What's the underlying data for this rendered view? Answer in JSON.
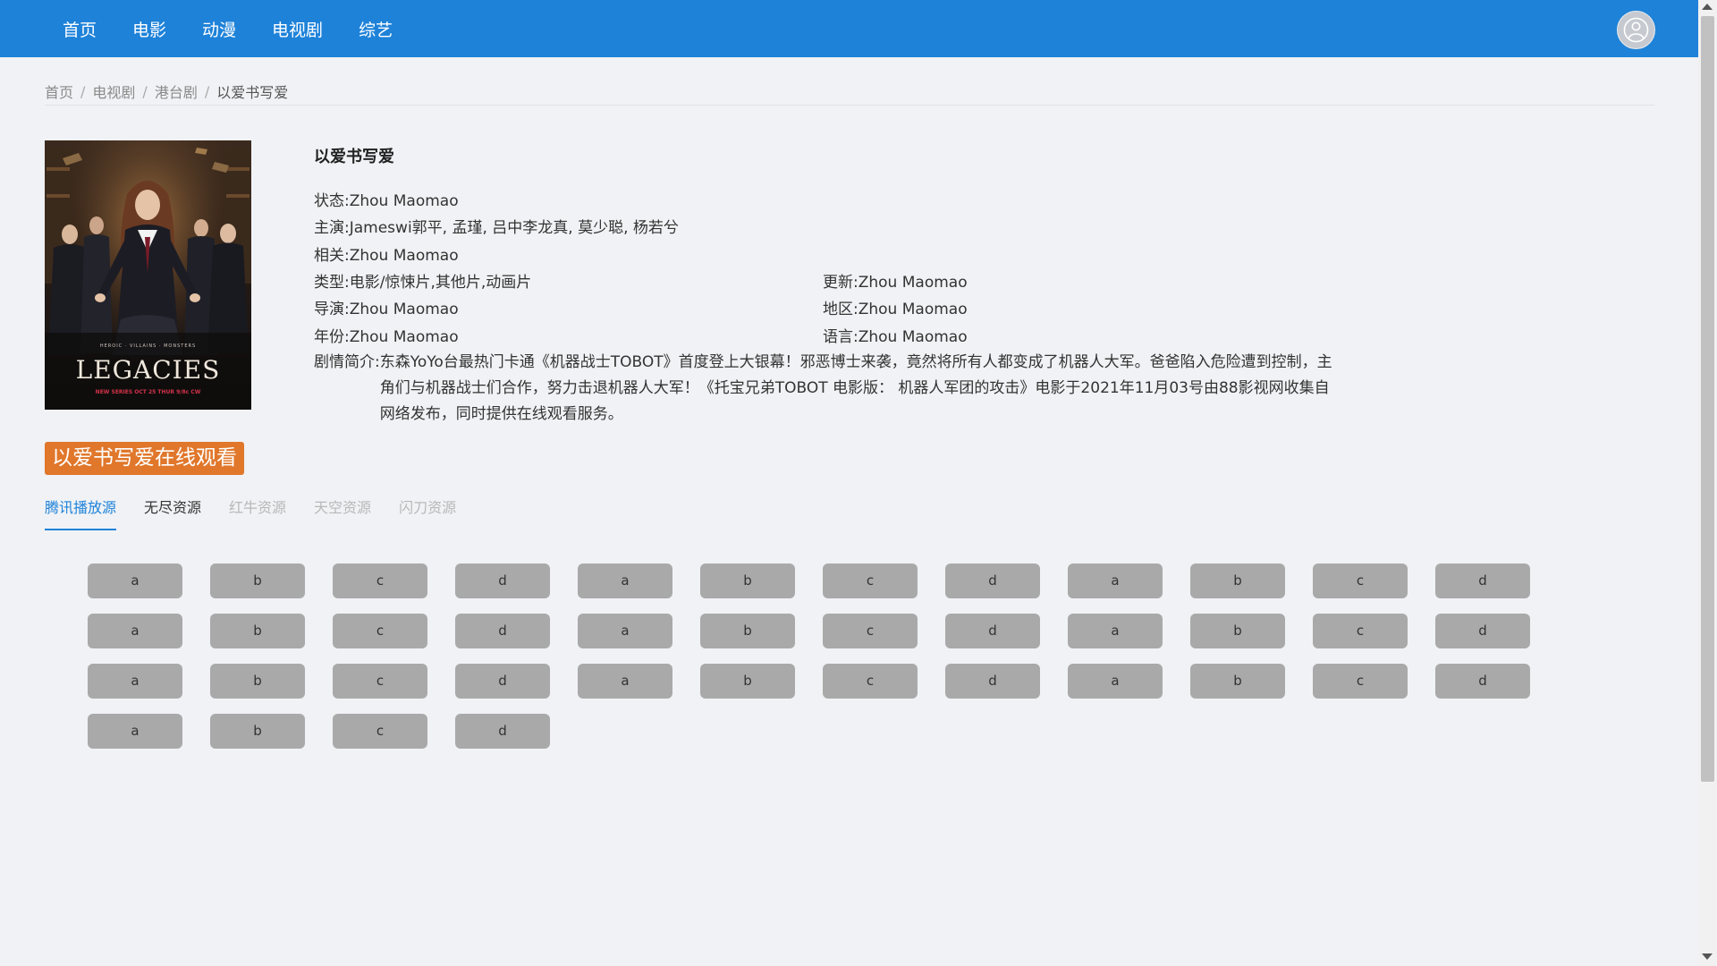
{
  "nav": {
    "items": [
      "首页",
      "电影",
      "动漫",
      "电视剧",
      "综艺"
    ],
    "avatar_icon": "user-avatar-icon"
  },
  "breadcrumb": {
    "items": [
      "首页",
      "电视剧",
      "港台剧"
    ],
    "current": "以爱书写爱",
    "separator": "/"
  },
  "poster": {
    "title_text": "LEGACIES",
    "tagline": "HEROIC · VILLAINS · MONSTERS",
    "date_text": "NEW SERIES OCT 25 THUR 9/8c",
    "network": "CW"
  },
  "info": {
    "title": "以爱书写爱",
    "status_label": "状态:",
    "status": "Zhou Maomao",
    "cast_label": "主演:",
    "cast": "Jameswi郭平, 孟瑾, 吕中李龙真, 莫少聪, 杨若兮",
    "related_label": "相关:",
    "related": "Zhou Maomao",
    "genre_label": "类型:",
    "genre": "电影/惊悚片,其他片,动画片",
    "update_label": "更新:",
    "update": "Zhou Maomao",
    "director_label": "导演:",
    "director": "Zhou Maomao",
    "region_label": "地区:",
    "region": "Zhou Maomao",
    "year_label": "年份:",
    "year": "Zhou Maomao",
    "language_label": "语言:",
    "language": "Zhou Maomao",
    "synopsis_label": "剧情简介:",
    "synopsis": "东森YoYo台最热门卡通《机器战士TOBOT》首度登上大银幕！邪恶博士来袭，竟然将所有人都变成了机器人大军。爸爸陷入危险遭到控制，主角们与机器战士们合作，努力击退机器人大军！《托宝兄弟TOBOT 电影版： 机器人军团的攻击》电影于2021年11月03号由88影视网收集自网络发布，同时提供在线观看服务。"
  },
  "watch_banner": "以爱书写爱在线观看",
  "source_tabs": [
    {
      "label": "腾讯播放源",
      "state": "active"
    },
    {
      "label": "无尽资源",
      "state": "normal"
    },
    {
      "label": "红牛资源",
      "state": "disabled"
    },
    {
      "label": "天空资源",
      "state": "disabled"
    },
    {
      "label": "闪刀资源",
      "state": "disabled"
    }
  ],
  "episodes": [
    "a",
    "b",
    "c",
    "d",
    "a",
    "b",
    "c",
    "d",
    "a",
    "b",
    "c",
    "d",
    "a",
    "b",
    "c",
    "d",
    "a",
    "b",
    "c",
    "d",
    "a",
    "b",
    "c",
    "d",
    "a",
    "b",
    "c",
    "d",
    "a",
    "b",
    "c",
    "d",
    "a",
    "b",
    "c",
    "d",
    "a",
    "b",
    "c",
    "d"
  ],
  "colors": {
    "nav_bg": "#1e82d9",
    "accent": "#1e82d9",
    "banner_bg": "#e0772b",
    "episode_bg": "#a9a9a9",
    "page_bg": "#f0f2f5"
  }
}
